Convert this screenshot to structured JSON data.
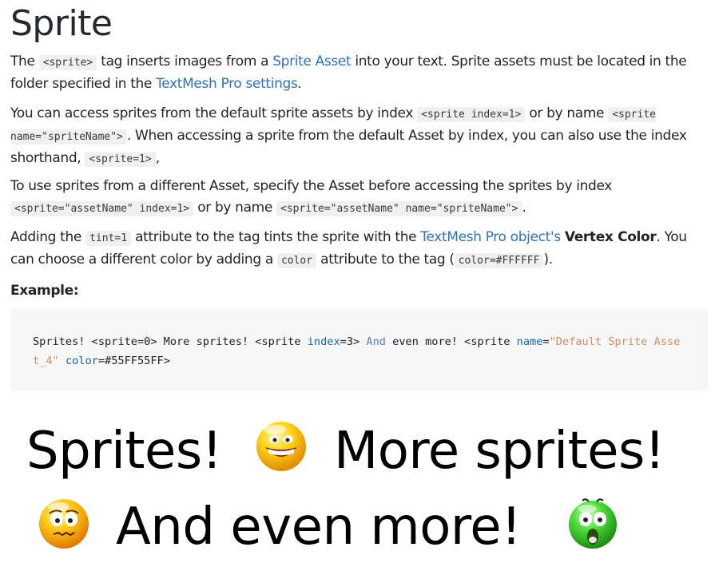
{
  "title": "Sprite",
  "p1": {
    "t1": "The ",
    "c1": "<sprite>",
    "t2": " tag inserts images from a ",
    "link1": "Sprite Asset",
    "t3": " into your text. Sprite assets must be located in the folder specified in the ",
    "link2": "TextMesh Pro settings",
    "t4": "."
  },
  "p2": {
    "t1": "You can access sprites from the default sprite assets by index ",
    "c1": "<sprite index=1>",
    "t2": " or by name ",
    "c2": "<sprite name=\"spriteName\">",
    "t3": ". When accessing a sprite from the default Asset by index, you can also use the index shorthand, ",
    "c3": "<sprite=1>",
    "t4": ","
  },
  "p3": {
    "t1": "To use sprites from a different Asset, specify the Asset before accessing the sprites by index ",
    "c1": "<sprite=\"assetName\" index=1>",
    "t2": " or by name ",
    "c2": "<sprite=\"assetName\" name=\"spriteName\">",
    "t3": "."
  },
  "p4": {
    "t1": "Adding the ",
    "c1": "tint=1",
    "t2": " attribute to the tag tints the sprite with the ",
    "link1": "TextMesh Pro object's",
    "t3": " ",
    "strong1": "Vertex Color",
    "t4": ". You can choose a different color by adding a ",
    "c2": "color",
    "t5": " attribute to the tag (",
    "c3": "color=#FFFFFF",
    "t6": ")."
  },
  "example_label": "Example:",
  "code": {
    "s1": "Sprites! <sprite=0> More sprites! <sprite ",
    "a1": "index",
    "s2": "=3> ",
    "k1": "And",
    "s3": " even more! <sprite ",
    "a2": "name",
    "s4": "=",
    "str1": "\"Default Sprite Asset_4\"",
    "s5": " ",
    "a3": "color",
    "s6": "=#55FF55FF>"
  },
  "render": {
    "line1_a": "Sprites!",
    "line1_b": "More sprites!",
    "line2": "And even more!"
  },
  "icons": {
    "sprite0": "grinning-face-emoji",
    "sprite3": "nervous-face-emoji",
    "sprite4": "shocked-face-emoji-green-tint"
  },
  "colors": {
    "link": "#2f72b6",
    "code_bg": "#f6f6f6",
    "inline_code_bg": "#f0f0f0",
    "tint": "#55FF55FF"
  }
}
